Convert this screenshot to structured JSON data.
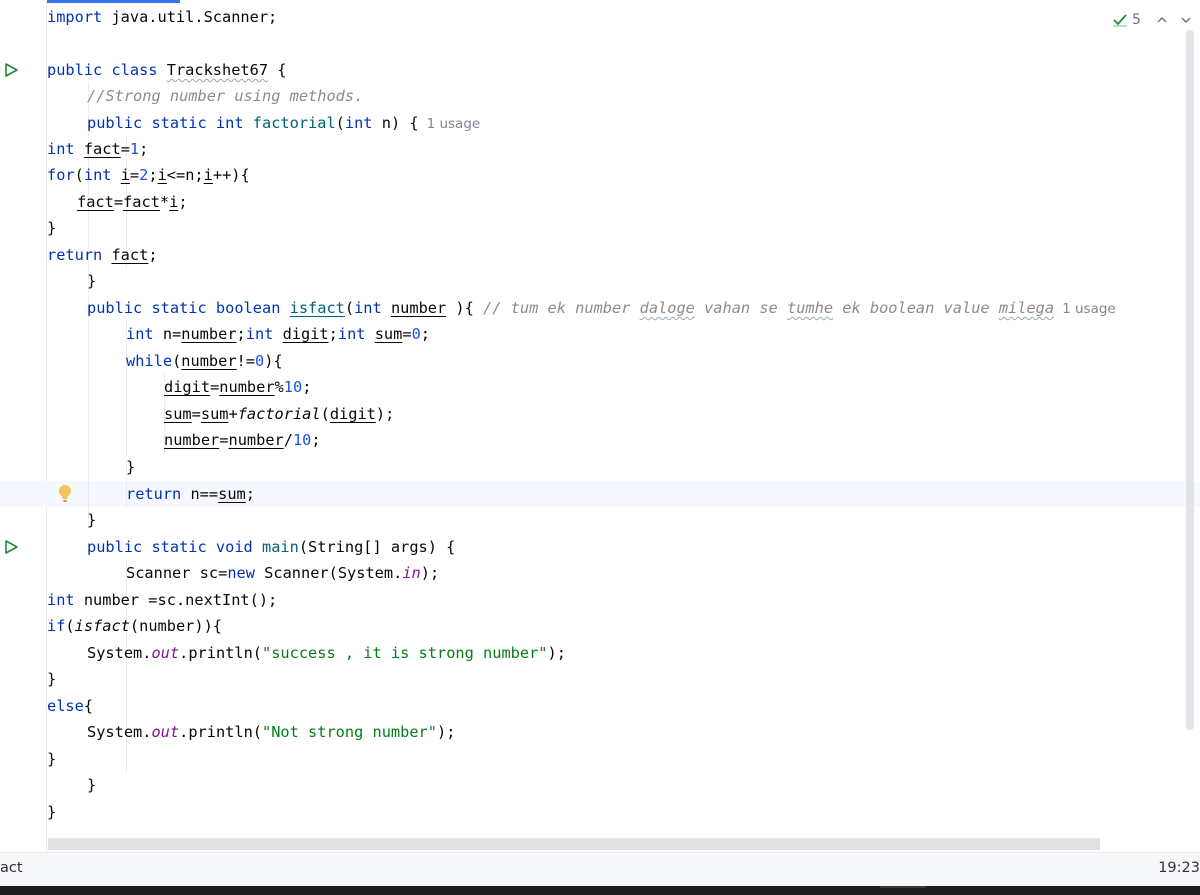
{
  "editor": {
    "inspection_count": "5",
    "lines": [
      {
        "t": "import java.util.Scanner;"
      },
      {
        "t": ""
      },
      {
        "t": "public class Trackshet67 {"
      },
      {
        "t": "//Strong number using methods."
      },
      {
        "t": "public static int factorial(int n) {"
      },
      {
        "t": "int fact=1;"
      },
      {
        "t": "for(int i=2;i<=n;i++){"
      },
      {
        "t": "fact=fact*i;"
      },
      {
        "t": "}"
      },
      {
        "t": "return fact;"
      },
      {
        "t": "}"
      },
      {
        "t": "public static boolean isfact(int number ){ // tum ek number daloge vahan se tumhe ek boolean value milega"
      },
      {
        "t": "int n=number;int digit;int sum=0;"
      },
      {
        "t": "while(number!=0){"
      },
      {
        "t": "digit=number%10;"
      },
      {
        "t": "sum=sum+factorial(digit);"
      },
      {
        "t": "number=number/10;"
      },
      {
        "t": "}"
      },
      {
        "t": "return n==sum;"
      },
      {
        "t": "}"
      },
      {
        "t": "public static void main(String[] args) {"
      },
      {
        "t": "Scanner sc=new Scanner(System.in);"
      },
      {
        "t": "int number =sc.nextInt();"
      },
      {
        "t": "if(isfact(number)){"
      },
      {
        "t": "System.out.println(\"success , it is strong number\");"
      },
      {
        "t": "}"
      },
      {
        "t": "else{"
      },
      {
        "t": "System.out.println(\"Not strong number\");"
      },
      {
        "t": "}"
      },
      {
        "t": "}"
      },
      {
        "t": "}"
      }
    ],
    "class_name": "Trackshet67",
    "comment_1": "//Strong number using methods.",
    "comment_2": "// tum ek number daloge vahan se tumhe ek boolean value milega",
    "usage_hint_1": "1 usage",
    "usage_hint_2": "1 usage",
    "string_1": "\"success , it is strong number\"",
    "string_2": "\"Not strong number\""
  },
  "status_bar": {
    "left_text": "act",
    "caret_position": "19:23"
  },
  "icons": {
    "run": "run-icon",
    "bulb": "lightbulb-icon",
    "inspection": "checkmark-icon",
    "chevron_up": "chevron-up-icon",
    "chevron_down": "chevron-down-icon"
  },
  "colors": {
    "keyword": "#0033b3",
    "number": "#1750eb",
    "string": "#067d17",
    "comment": "#8c8c8c",
    "field": "#871094",
    "inspection_ok": "#208a3c",
    "bulb": "#f2c55c"
  }
}
